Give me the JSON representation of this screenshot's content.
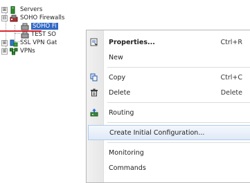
{
  "tree": {
    "servers": {
      "expander": "⊞",
      "label": "Servers",
      "icon": "server-icon"
    },
    "soho_firewalls": {
      "expander": "⊟",
      "label": "SOHO Firewalls",
      "icon": "firewall-group-icon"
    },
    "soho_fi": {
      "label": "SOHO Fi",
      "icon": "firewall-icon",
      "selected": true
    },
    "test_so": {
      "label": "TEST SO",
      "icon": "firewall-icon"
    },
    "ssl_vpn": {
      "expander": "⊞",
      "label": "SSL VPN Gat",
      "icon": "ssl-vpn-gateway-icon"
    },
    "vpns": {
      "expander": "⊞",
      "label": "VPNs",
      "icon": "vpn-icon"
    }
  },
  "context_menu": {
    "properties": {
      "label": "Properties...",
      "shortcut": "Ctrl+R",
      "icon": "properties-icon"
    },
    "new": {
      "label": "New",
      "submenu": true
    },
    "copy": {
      "label": "Copy",
      "shortcut": "Ctrl+C",
      "icon": "copy-icon"
    },
    "delete": {
      "label": "Delete",
      "shortcut": "Delete",
      "icon": "delete-icon"
    },
    "routing": {
      "label": "Routing",
      "icon": "routing-icon"
    },
    "create_initial": {
      "label": "Create Initial Configuration...",
      "highlighted": true
    },
    "monitoring": {
      "label": "Monitoring",
      "submenu": true
    },
    "commands": {
      "label": "Commands",
      "submenu": true
    }
  },
  "colors": {
    "selection": "#3169c6",
    "callout": "#d8262e",
    "highlight_border": "#aecbf0"
  }
}
